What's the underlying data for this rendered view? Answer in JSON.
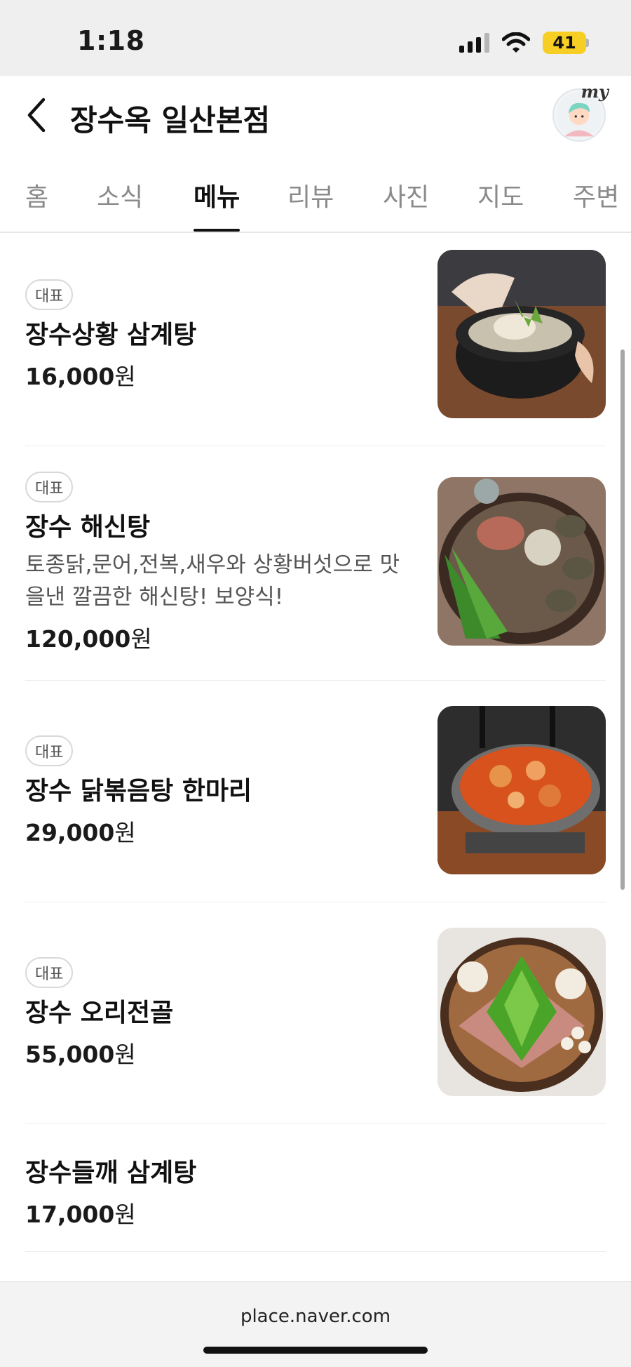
{
  "status_bar": {
    "time": "1:18",
    "battery": "41",
    "battery_color": "#f7cf24"
  },
  "header": {
    "title": "장수옥 일산본점",
    "avatar_label": "my"
  },
  "tabs": [
    {
      "label": "홈",
      "active": false
    },
    {
      "label": "소식",
      "active": false
    },
    {
      "label": "메뉴",
      "active": true
    },
    {
      "label": "리뷰",
      "active": false
    },
    {
      "label": "사진",
      "active": false
    },
    {
      "label": "지도",
      "active": false
    },
    {
      "label": "주변",
      "active": false
    }
  ],
  "menu": [
    {
      "badge": "대표",
      "name": "장수상황 삼계탕",
      "description": "",
      "price": "16,000",
      "currency": "원",
      "has_photo": true,
      "photo_icon": "samgyetang-photo"
    },
    {
      "badge": "대표",
      "name": "장수 해신탕",
      "description": "토종닭,문어,전복,새우와 상황버섯으로 맛을낸 깔끔한 해신탕! 보양식!",
      "price": "120,000",
      "currency": "원",
      "has_photo": true,
      "photo_icon": "haesintang-photo"
    },
    {
      "badge": "대표",
      "name": "장수 닭볶음탕 한마리",
      "description": "",
      "price": "29,000",
      "currency": "원",
      "has_photo": true,
      "photo_icon": "dakbokkeumtang-photo"
    },
    {
      "badge": "대표",
      "name": "장수 오리전골",
      "description": "",
      "price": "55,000",
      "currency": "원",
      "has_photo": true,
      "photo_icon": "duck-hotpot-photo"
    },
    {
      "badge": "",
      "name": "장수들깨 삼계탕",
      "description": "",
      "price": "17,000",
      "currency": "원",
      "has_photo": false
    }
  ],
  "url_bar": {
    "url": "place.naver.com"
  }
}
